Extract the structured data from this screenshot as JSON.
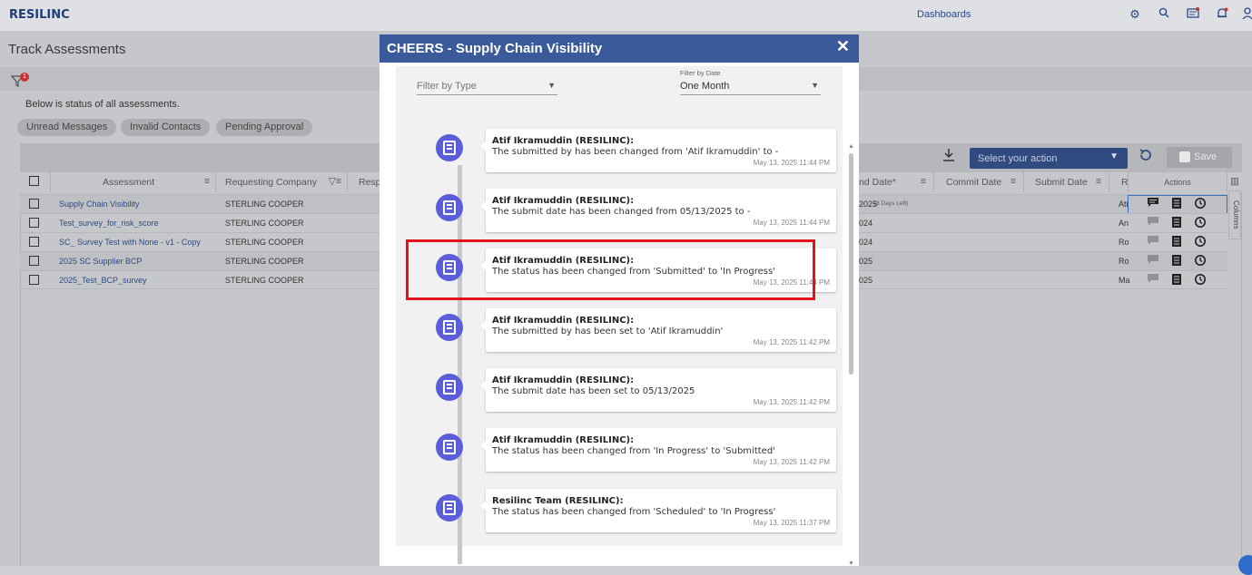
{
  "topbar": {
    "logo": "RESILINC",
    "dashboards": "Dashboards"
  },
  "page": {
    "title": "Track Assessments",
    "filter_badge": "1",
    "status_line": "Below is status of all assessments."
  },
  "chips": [
    "Unread Messages",
    "Invalid Contacts",
    "Pending Approval"
  ],
  "toolbar": {
    "action_placeholder": "Select your action",
    "save_label": "Save"
  },
  "grid": {
    "headers": {
      "assessment": "Assessment",
      "requesting_company": "Requesting Company",
      "resp": "Resp",
      "end_date": "nd Date*",
      "commit_date": "Commit Date",
      "submit_date": "Submit Date",
      "r": "R",
      "actions": "Actions"
    },
    "columns_label": "Columns",
    "rows": [
      {
        "assessment": "Supply Chain Visibility",
        "company": "STERLING COOPER",
        "end_date": "2025",
        "days_left": "(8 Days Left)",
        "r": "Ati"
      },
      {
        "assessment": "Test_survey_for_risk_score",
        "company": "STERLING COOPER",
        "end_date": "024",
        "days_left": "",
        "r": "An"
      },
      {
        "assessment": "SC_ Survey Test with None - v1 - Copy",
        "company": "STERLING COOPER",
        "end_date": "024",
        "days_left": "",
        "r": "Ro"
      },
      {
        "assessment": "2025 SC Supplier BCP",
        "company": "STERLING COOPER",
        "end_date": "025",
        "days_left": "",
        "r": "Ro"
      },
      {
        "assessment": "2025_Test_BCP_survey",
        "company": "STERLING COOPER",
        "end_date": "025",
        "days_left": "",
        "r": "Ma"
      }
    ]
  },
  "modal": {
    "title": "CHEERS - Supply Chain Visibility",
    "filter_type_placeholder": "Filter by Type",
    "filter_date_label": "Filter by Date",
    "filter_date_value": "One Month",
    "entries": [
      {
        "name": "Atif Ikramuddin (RESILINC):",
        "text": "The submitted by has been changed from 'Atif Ikramuddin' to -",
        "time": "May 13, 2025 11:44 PM"
      },
      {
        "name": "Atif Ikramuddin (RESILINC):",
        "text": "The submit date has been changed from 05/13/2025 to -",
        "time": "May 13, 2025 11:44 PM"
      },
      {
        "name": "Atif Ikramuddin (RESILINC):",
        "text": "The status has been changed from 'Submitted' to 'In Progress'",
        "time": "May 13, 2025 11:44 PM"
      },
      {
        "name": "Atif Ikramuddin (RESILINC):",
        "text": "The submitted by has been set to 'Atif Ikramuddin'",
        "time": "May 13, 2025 11:42 PM"
      },
      {
        "name": "Atif Ikramuddin (RESILINC):",
        "text": "The submit date has been set to 05/13/2025",
        "time": "May 13, 2025 11:42 PM"
      },
      {
        "name": "Atif Ikramuddin (RESILINC):",
        "text": "The status has been changed from 'In Progress' to 'Submitted'",
        "time": "May 13, 2025 11:42 PM"
      },
      {
        "name": "Resilinc Team (RESILINC):",
        "text": "The status has been changed from 'Scheduled' to 'In Progress'",
        "time": "May 13, 2025 11:37 PM"
      }
    ]
  },
  "icons": [
    "gear-icon",
    "search-icon",
    "message-icon",
    "bell-icon",
    "user-icon",
    "filter-icon",
    "download-icon",
    "refresh-icon",
    "save-icon",
    "chat-icon",
    "notes-icon",
    "history-icon",
    "close-icon",
    "timeline-entry-icon"
  ]
}
